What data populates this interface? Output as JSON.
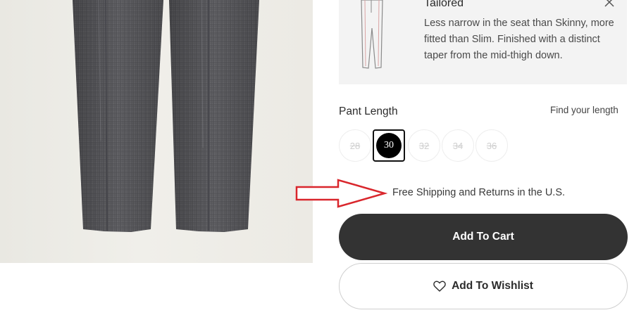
{
  "fit": {
    "title": "Tailored",
    "description": "Less narrow in the seat than Skinny, more fitted than Slim. Finished with a distinct taper from the mid-thigh down.",
    "close_icon": "close-icon"
  },
  "length": {
    "label": "Pant Length",
    "find_link": "Find your length",
    "selected": "30",
    "options": [
      {
        "value": "28",
        "available": false
      },
      {
        "value": "30",
        "available": true
      },
      {
        "value": "32",
        "available": false
      },
      {
        "value": "34",
        "available": false
      },
      {
        "value": "36",
        "available": false
      }
    ]
  },
  "shipping": {
    "text": "Free Shipping and Returns in the U.S."
  },
  "actions": {
    "add_to_cart": "Add To Cart",
    "add_to_wishlist": "Add To Wishlist",
    "wishlist_icon": "heart-icon"
  },
  "colors": {
    "cart_button": "#333333",
    "card_background": "#f3f3f3",
    "annotation_arrow": "#d9262c"
  }
}
